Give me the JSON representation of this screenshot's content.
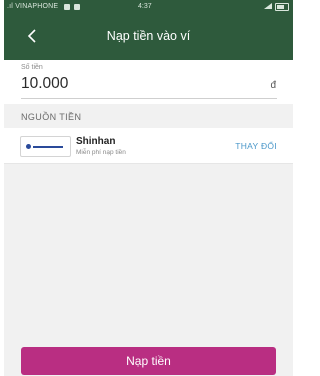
{
  "status_bar": {
    "carrier": ".ıl VINAPHONE",
    "time": "4:37"
  },
  "header": {
    "title": "Nạp tiền vào ví"
  },
  "amount": {
    "label": "Số tiền",
    "value": "10.000",
    "currency": "đ"
  },
  "source": {
    "section_title": "NGUỒN TIỀN",
    "bank_name": "Shinhan",
    "bank_subtitle": "Miễn phí nạp tiền",
    "change_label": "THAY ĐỔI"
  },
  "submit": {
    "label": "Nạp tiền"
  },
  "colors": {
    "header": "#2e5a3c",
    "accent_button": "#b92e82",
    "link": "#4a97c9"
  }
}
